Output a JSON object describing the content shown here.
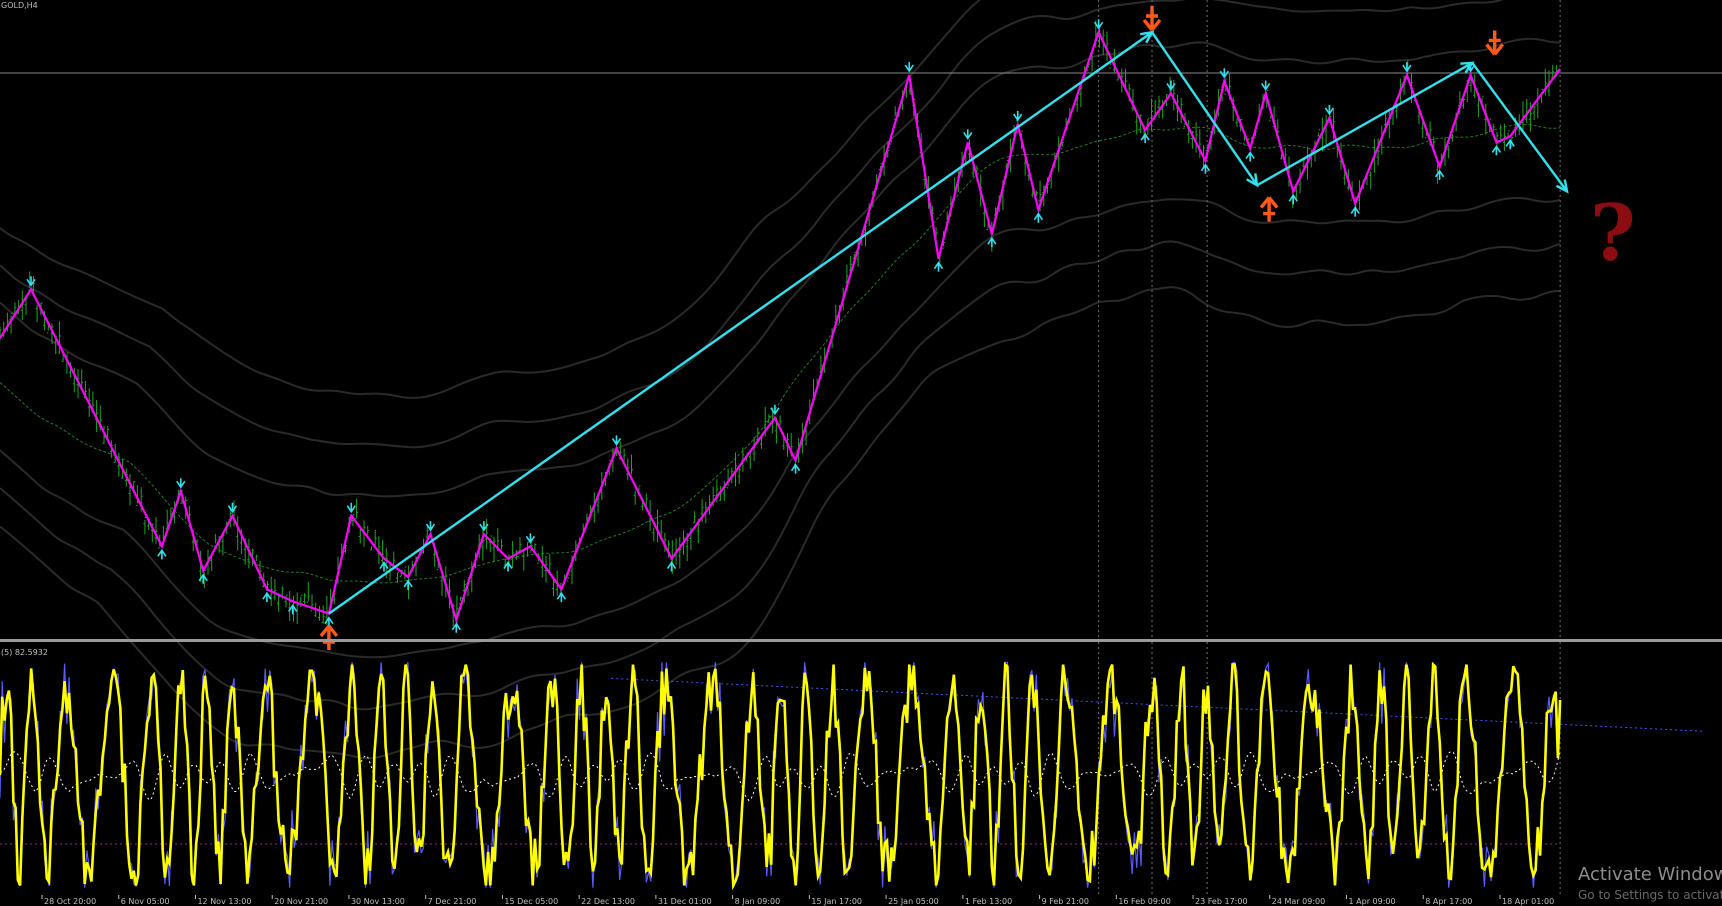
{
  "window_title": "GOLD,H4",
  "oscillator_label": "(5) 82.5932",
  "question_mark": "?",
  "watermark": {
    "line1": "Activate Windows",
    "line2": "Go to Settings to activate Windows."
  },
  "colors": {
    "background": "#000000",
    "bars": "#1fa51f",
    "zigzag": "#ff00ff",
    "trend": "#33e0ee",
    "arrows": "#ff5a1a",
    "markers": "#33e0ee",
    "envelope": "#2a2a2a",
    "ma": "#1e7a1e",
    "oscillator_fast": "#ffff00",
    "oscillator_slow": "#5a5aff",
    "signal": "#ffffff",
    "separator": "#9a9a9a",
    "question": "#8b0d12"
  },
  "chart_data": {
    "type": "line",
    "symbol": "GOLD",
    "timeframe": "H4",
    "x_labels": [
      "28 Oct 20:00",
      "6 Nov 05:00",
      "12 Nov 13:00",
      "20 Nov 21:00",
      "30 Nov 13:00",
      "7 Dec 21:00",
      "15 Dec 05:00",
      "22 Dec 13:00",
      "31 Dec 01:00",
      "8 Jan 09:00",
      "15 Jan 17:00",
      "25 Jan 05:00",
      "1 Feb 13:00",
      "9 Feb 21:00",
      "16 Feb 09:00",
      "23 Feb 17:00",
      "24 Mar 09:00",
      "1 Apr 09:00",
      "8 Apr 17:00",
      "18 Apr 01:00"
    ],
    "zigzag_points": [
      {
        "x": 0.0,
        "y": 0.48
      },
      {
        "x": 0.018,
        "y": 0.56
      },
      {
        "x": 0.094,
        "y": 0.14
      },
      {
        "x": 0.105,
        "y": 0.23
      },
      {
        "x": 0.118,
        "y": 0.1
      },
      {
        "x": 0.135,
        "y": 0.19
      },
      {
        "x": 0.155,
        "y": 0.07
      },
      {
        "x": 0.17,
        "y": 0.05
      },
      {
        "x": 0.191,
        "y": 0.03
      },
      {
        "x": 0.204,
        "y": 0.19
      },
      {
        "x": 0.223,
        "y": 0.12
      },
      {
        "x": 0.237,
        "y": 0.09
      },
      {
        "x": 0.25,
        "y": 0.16
      },
      {
        "x": 0.265,
        "y": 0.02
      },
      {
        "x": 0.281,
        "y": 0.16
      },
      {
        "x": 0.295,
        "y": 0.12
      },
      {
        "x": 0.308,
        "y": 0.14
      },
      {
        "x": 0.326,
        "y": 0.07
      },
      {
        "x": 0.358,
        "y": 0.3
      },
      {
        "x": 0.39,
        "y": 0.12
      },
      {
        "x": 0.45,
        "y": 0.35
      },
      {
        "x": 0.462,
        "y": 0.28
      },
      {
        "x": 0.528,
        "y": 0.91
      },
      {
        "x": 0.545,
        "y": 0.61
      },
      {
        "x": 0.562,
        "y": 0.8
      },
      {
        "x": 0.576,
        "y": 0.65
      },
      {
        "x": 0.591,
        "y": 0.83
      },
      {
        "x": 0.603,
        "y": 0.69
      },
      {
        "x": 0.638,
        "y": 0.98
      },
      {
        "x": 0.665,
        "y": 0.82
      },
      {
        "x": 0.68,
        "y": 0.88
      },
      {
        "x": 0.7,
        "y": 0.77
      },
      {
        "x": 0.711,
        "y": 0.9
      },
      {
        "x": 0.726,
        "y": 0.79
      },
      {
        "x": 0.735,
        "y": 0.88
      },
      {
        "x": 0.751,
        "y": 0.72
      },
      {
        "x": 0.772,
        "y": 0.84
      },
      {
        "x": 0.787,
        "y": 0.7
      },
      {
        "x": 0.817,
        "y": 0.91
      },
      {
        "x": 0.836,
        "y": 0.76
      },
      {
        "x": 0.854,
        "y": 0.91
      },
      {
        "x": 0.869,
        "y": 0.8
      },
      {
        "x": 0.877,
        "y": 0.81
      },
      {
        "x": 0.906,
        "y": 0.92
      }
    ],
    "trend_lines": [
      {
        "from": {
          "x": 0.191,
          "y": 0.03
        },
        "to": {
          "x": 0.669,
          "y": 0.98
        }
      },
      {
        "from": {
          "x": 0.669,
          "y": 0.98
        },
        "to": {
          "x": 0.73,
          "y": 0.73
        }
      },
      {
        "from": {
          "x": 0.73,
          "y": 0.73
        },
        "to": {
          "x": 0.855,
          "y": 0.93
        }
      },
      {
        "from": {
          "x": 0.855,
          "y": 0.93
        },
        "to": {
          "x": 0.91,
          "y": 0.72
        }
      }
    ],
    "buy_signals": [
      {
        "x": 0.191,
        "y": 0.0
      },
      {
        "x": 0.737,
        "y": 0.7
      }
    ],
    "sell_signals": [
      {
        "x": 0.669,
        "y": 1.0
      },
      {
        "x": 0.868,
        "y": 0.96
      }
    ],
    "oscillator": {
      "period": 5,
      "current_value": 82.5932,
      "range": [
        0,
        100
      ],
      "levels": [
        80,
        20
      ]
    }
  }
}
